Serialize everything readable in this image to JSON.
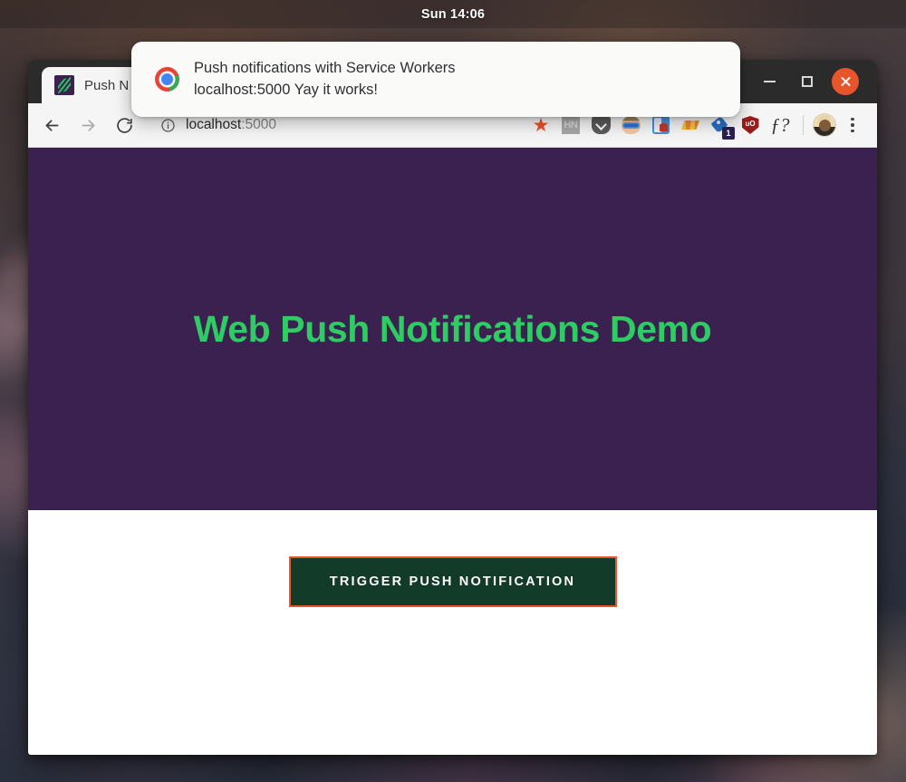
{
  "desktop": {
    "topbar": {
      "clock": "Sun 14:06"
    }
  },
  "window": {
    "tab": {
      "title": "Push N",
      "favicon_name": "push-demo-favicon"
    },
    "controls": {
      "minimize": "–",
      "maximize": "□",
      "close": "×"
    },
    "toolbar": {
      "back_icon": "arrow-left-icon",
      "forward_icon": "arrow-right-icon",
      "reload_icon": "reload-icon",
      "site_info_icon": "info-icon",
      "url_host": "localhost",
      "url_port": ":5000",
      "extensions": [
        {
          "name": "bookmark-star-icon",
          "label": "★",
          "badge": ""
        },
        {
          "name": "hacker-news-icon",
          "label": "HN",
          "badge": ""
        },
        {
          "name": "pocket-icon",
          "label": "",
          "badge": ""
        },
        {
          "name": "goggles-avatar-icon",
          "label": "",
          "badge": ""
        },
        {
          "name": "lock-document-icon",
          "label": "",
          "badge": ""
        },
        {
          "name": "orange-triangle-icon",
          "label": "",
          "badge": ""
        },
        {
          "name": "blue-tag-icon",
          "label": "",
          "badge": "1"
        },
        {
          "name": "ublock-origin-icon",
          "label": "uO",
          "badge": ""
        },
        {
          "name": "function-question-icon",
          "label": "ƒ?",
          "badge": ""
        }
      ],
      "avatar_name": "profile-avatar",
      "menu_icon": "three-dot-menu-icon"
    },
    "page": {
      "heading": "Web Push Notifications Demo",
      "trigger_button": "TRIGGER PUSH NOTIFICATION",
      "hero_bg": "#3a2150",
      "heading_color": "#2ecc63",
      "button_bg": "#133b29",
      "button_outline": "#e8552a"
    }
  },
  "notification": {
    "app_icon": "chrome-logo-icon",
    "title": "Push notifications with Service Workers",
    "body": "localhost:5000  Yay it works!"
  }
}
